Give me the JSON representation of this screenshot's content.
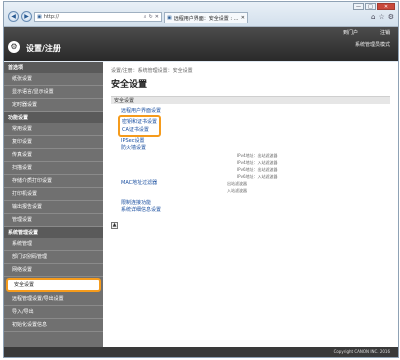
{
  "browser": {
    "url": "http://",
    "tab_title": "远程用户界面：安全设置 : ...",
    "back_icon": "back-arrow-icon",
    "forward_icon": "forward-arrow-icon",
    "window_controls": {
      "minimize": "—",
      "maximize": "□",
      "close": "✕"
    },
    "chrome_icons": [
      "⌂",
      "☆",
      "⚙"
    ]
  },
  "header": {
    "logo": "⚙",
    "title": "设置/注册",
    "links": [
      "到门户",
      "注销"
    ],
    "admin_label": "系统管理员模式"
  },
  "sidebar": {
    "sections": [
      {
        "title": "首选项",
        "items": [
          "纸张设置",
          "显示语言/显示设置",
          "定时器设置"
        ]
      },
      {
        "title": "功能设置",
        "items": [
          "常用设置",
          "复印设置",
          "传真设置",
          "扫描设置",
          "存储介质打印设置",
          "打印机设置",
          "输出报告设置",
          "管理设置"
        ]
      },
      {
        "title": "系统管理设置",
        "items": [
          "系统管理",
          "部门识别码管理",
          "网络设置",
          "安全设置",
          "远程管理设置/导出设置",
          "导入/导出",
          "初始化设置信息"
        ]
      }
    ],
    "active": "安全设置"
  },
  "content": {
    "breadcrumb": "设置/注册：系统管理设置：安全设置",
    "title": "安全设置",
    "section": "安全设置",
    "links": {
      "remote_password": "远程用户界面设置",
      "key_cert": "密钥和证书设置",
      "ca_cert": "CA证书设置",
      "ipsec": "IPSec设置",
      "firewall": "防火墙设置",
      "mac_filter": "MAC地址过滤器",
      "restrict": "限制连接功能",
      "system_info": "系统详细信息设置"
    },
    "firewall_status": [
      "IPv4地址：出站滤波器",
      "IPv4地址：入站滤波器",
      "IPv6地址：出站滤波器",
      "IPv6地址：入站滤波器"
    ],
    "mac_status": [
      "出站滤波器",
      "入站滤波器"
    ],
    "top_icon": "▲"
  },
  "footer": {
    "copyright": "Copyright CANON INC. 2016"
  },
  "colors": {
    "highlight": "#f59b1c",
    "sidebar": "#707070",
    "header": "#2a2a2a",
    "link": "#1a4fa0"
  }
}
